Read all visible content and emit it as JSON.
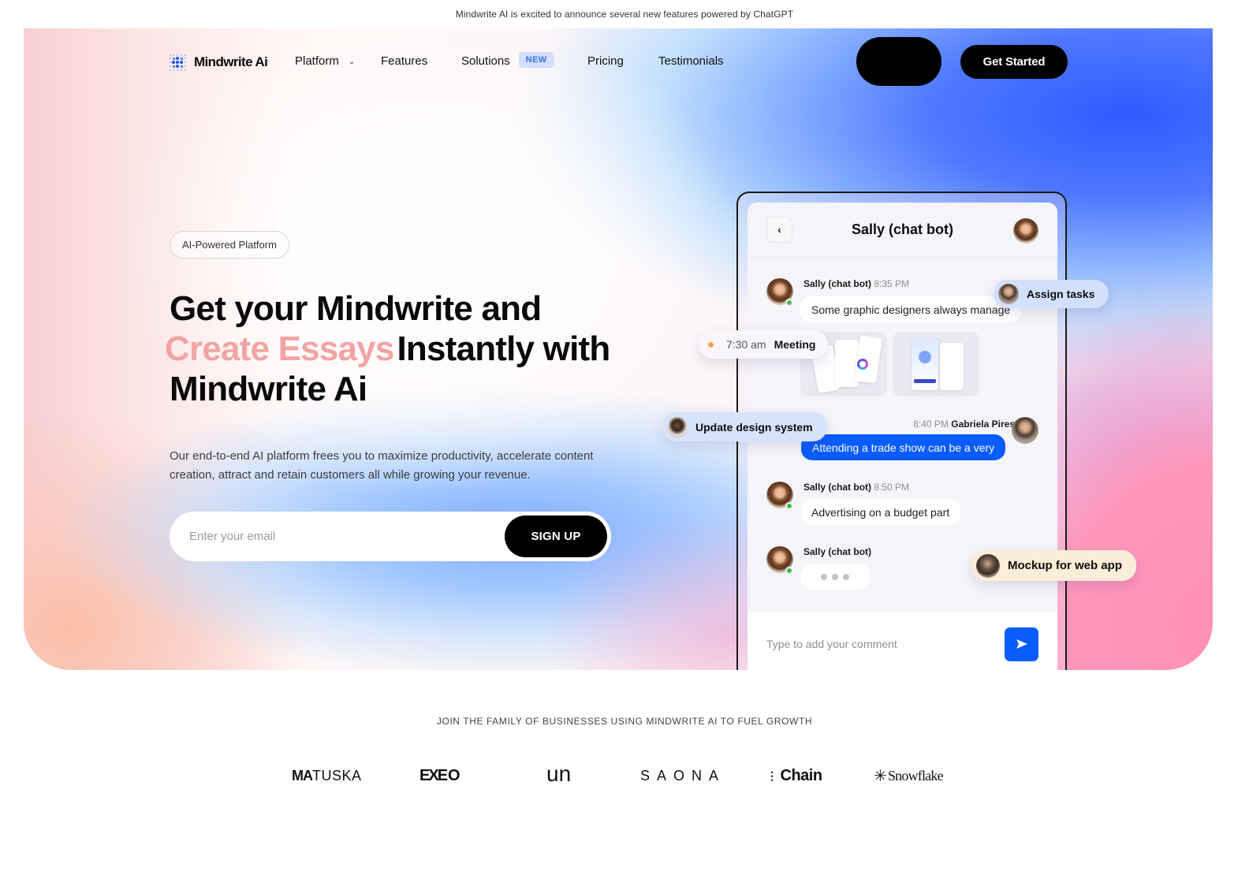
{
  "announcement": "Mindwrite AI is excited to announce several new features powered by ChatGPT",
  "brand": {
    "name": "Mindwrite Ai",
    "icon": "dot-grid-icon",
    "accent": "#2156e8"
  },
  "nav": {
    "items": [
      {
        "label": "Platform",
        "has_dropdown": true
      },
      {
        "label": "Features"
      },
      {
        "label": "Solutions",
        "badge": "NEW"
      },
      {
        "label": "Pricing"
      },
      {
        "label": "Testimonials"
      }
    ],
    "cta": "Get Started"
  },
  "hero": {
    "pill": "AI-Powered Platform",
    "headline": {
      "line1": "Get your Mindwrite and",
      "accent": "Create Essays",
      "line2_rest": "Instantly with",
      "line3": "Mindwrite Ai"
    },
    "accent_color": "#f2a4a4",
    "description": "Our end-to-end AI platform frees you to maximize productivity, accelerate content creation, attract and retain customers all while growing your revenue.",
    "email_placeholder": "Enter your email",
    "signup_label": "SIGN UP"
  },
  "chat": {
    "title": "Sally (chat bot)",
    "messages": [
      {
        "sender": "Sally (chat bot)",
        "time": "8:35 PM",
        "text": "Some graphic designers always manage"
      },
      {
        "sender": "Gabriela Pires",
        "time": "8:40 PM",
        "text": "Attending a trade show can be a very"
      },
      {
        "sender": "Sally (chat bot)",
        "time": "8:50 PM",
        "text": "Advertising on a budget part"
      },
      {
        "sender": "Sally (chat bot)",
        "time": "",
        "text": ""
      }
    ],
    "comment_placeholder": "Type to add your comment",
    "send_color": "#0a5cff"
  },
  "floating_tags": {
    "assign": "Assign tasks",
    "meeting_time": "7:30 am",
    "meeting_label": "Meeting",
    "update": "Update design system",
    "mockup": "Mockup for web app"
  },
  "partners": {
    "title": "JOIN THE FAMILY OF BUSINESSES USING MINDWRITE AI TO FUEL GROWTH",
    "logos": [
      {
        "bold": "MA",
        "rest": "TUSKA"
      },
      {
        "bold": "EX",
        "rest": "EO"
      },
      {
        "text": "un"
      },
      {
        "text": "SAONA"
      },
      {
        "text": "Chain"
      },
      {
        "text": "Snowflake"
      }
    ]
  }
}
